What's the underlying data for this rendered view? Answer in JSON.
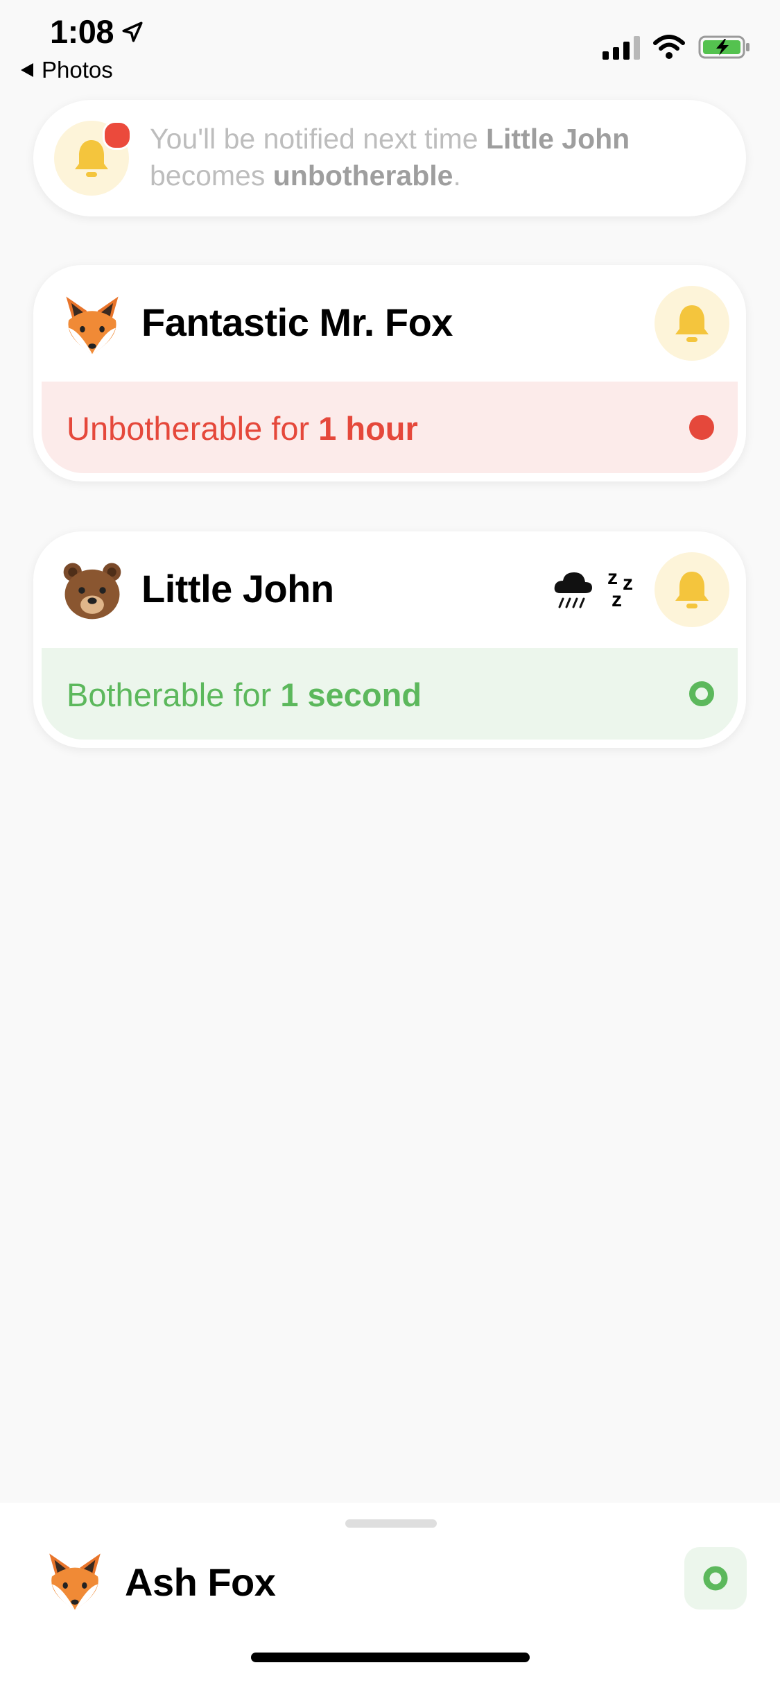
{
  "status_bar": {
    "time": "1:08",
    "back_label": "Photos"
  },
  "notice": {
    "pre": "You'll be notified next time ",
    "name": "Little John",
    "mid": " becomes ",
    "state": "unbotherable",
    "post": "."
  },
  "contacts": [
    {
      "name": "Fantastic Mr. Fox",
      "emoji": "fox",
      "status_prefix": "Unbotherable for ",
      "status_duration": "1 hour",
      "status_color": "#e5483b",
      "status_bg": "#fcebea"
    },
    {
      "name": "Little John",
      "emoji": "bear",
      "extra_icons": [
        "rain-cloud-icon",
        "zzz-icon"
      ],
      "status_prefix": "Botherable for ",
      "status_duration": "1 second",
      "status_color": "#5cb85c",
      "status_bg": "#ecf6ec"
    }
  ],
  "me": {
    "name": "Ash Fox",
    "emoji": "fox",
    "status_color": "#5cb85c"
  },
  "colors": {
    "bell": "#f4c53d",
    "bell_bg": "#fdf4d9",
    "badge_red": "#eb4a3c",
    "background": "#f9f9f9"
  }
}
